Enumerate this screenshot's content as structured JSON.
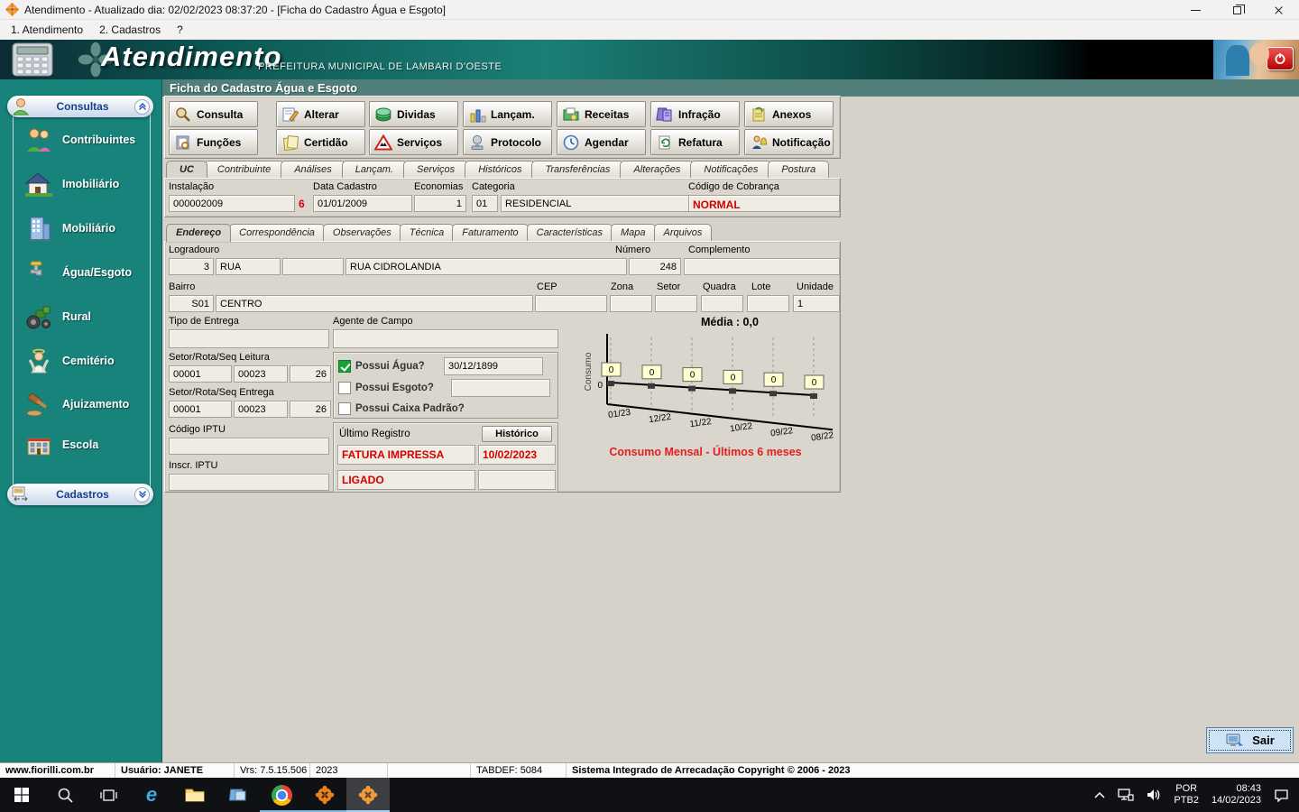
{
  "window": {
    "title": "Atendimento - Atualizado dia: 02/02/2023 08:37:20 - [Ficha do Cadastro Água e Esgoto]"
  },
  "menu_bar": {
    "items": [
      "1. Atendimento",
      "2. Cadastros",
      "?"
    ]
  },
  "banner": {
    "app_name": "Atendimento",
    "subtitle": "PREFEITURA MUNICIPAL DE LAMBARI D'OESTE"
  },
  "page": {
    "title": "Ficha do Cadastro Água e Esgoto"
  },
  "sidebar": {
    "consultas_label": "Consultas",
    "cadastros_label": "Cadastros",
    "items": [
      {
        "label": "Contribuintes",
        "icon": "people-icon"
      },
      {
        "label": "Imobiliário",
        "icon": "house-icon"
      },
      {
        "label": "Mobiliário",
        "icon": "building-icon"
      },
      {
        "label": "Água/Esgoto",
        "icon": "faucet-icon"
      },
      {
        "label": "Rural",
        "icon": "tractor-icon"
      },
      {
        "label": "Cemitério",
        "icon": "angel-icon"
      },
      {
        "label": "Ajuizamento",
        "icon": "gavel-icon"
      },
      {
        "label": "Escola",
        "icon": "school-icon"
      }
    ]
  },
  "toolbar": {
    "row1": [
      {
        "label": "Consulta",
        "icon": "magnifier-icon"
      },
      {
        "label": "Alterar",
        "icon": "edit-icon"
      },
      {
        "label": "Dividas",
        "icon": "books-icon"
      },
      {
        "label": "Lançam.",
        "icon": "chart-bars-icon"
      },
      {
        "label": "Receitas",
        "icon": "folder-money-icon"
      },
      {
        "label": "Infração",
        "icon": "violation-icon"
      },
      {
        "label": "Anexos",
        "icon": "attachment-icon"
      }
    ],
    "row2": [
      {
        "label": "Funções",
        "icon": "clipboard-icon"
      },
      {
        "label": "Certidão",
        "icon": "certificate-icon"
      },
      {
        "label": "Serviços",
        "icon": "warning-icon"
      },
      {
        "label": "Protocolo",
        "icon": "stamp-icon"
      },
      {
        "label": "Agendar",
        "icon": "clock-icon"
      },
      {
        "label": "Refatura",
        "icon": "refresh-doc-icon"
      },
      {
        "label": "Notificação",
        "icon": "notify-icon"
      }
    ]
  },
  "tabs": {
    "active": "UC",
    "items": [
      "UC",
      "Contribuinte",
      "Análises",
      "Lançam.",
      "Serviços",
      "Históricos",
      "Transferências",
      "Alterações",
      "Notificações",
      "Postura"
    ]
  },
  "record": {
    "instalacao_label": "Instalação",
    "instalacao": "000002009",
    "instalacao_flag": "6",
    "data_cadastro_label": "Data Cadastro",
    "data_cadastro": "01/01/2009",
    "economias_label": "Economias",
    "economias": "1",
    "categoria_label": "Categoria",
    "categoria_codigo": "01",
    "categoria_descricao": "RESIDENCIAL",
    "cobranca_label": "Código de Cobrança",
    "cobranca": "NORMAL"
  },
  "subtabs": {
    "active": "Endereço",
    "items": [
      "Endereço",
      "Correspondência",
      "Observações",
      "Técnica",
      "Faturamento",
      "Características",
      "Mapa",
      "Arquivos"
    ]
  },
  "address": {
    "logradouro_label": "Logradouro",
    "numero_label": "Número",
    "complemento_label": "Complemento",
    "logradouro_codigo": "3",
    "logradouro_tipo": "RUA",
    "logradouro_extra": "",
    "logradouro_nome": "RUA CIDROLANDIA",
    "numero": "248",
    "complemento": "",
    "bairro_label": "Bairro",
    "cep_label": "CEP",
    "zona_label": "Zona",
    "setor_label": "Setor",
    "quadra_label": "Quadra",
    "lote_label": "Lote",
    "unidade_label": "Unidade",
    "bairro_codigo": "S01",
    "bairro_nome": "CENTRO",
    "cep": "",
    "zona": "",
    "setor": "",
    "quadra": "",
    "lote": "",
    "unidade": "1",
    "tipo_entrega_label": "Tipo de Entrega",
    "tipo_entrega": "",
    "agente_campo_label": "Agente de Campo",
    "agente_campo": ""
  },
  "leitura": {
    "leitura_label": "Setor/Rota/Seq Leitura",
    "leitura_setor": "00001",
    "leitura_rota": "00023",
    "leitura_seq": "26",
    "entrega_label": "Setor/Rota/Seq Entrega",
    "entrega_setor": "00001",
    "entrega_rota": "00023",
    "entrega_seq": "26",
    "codigo_iptu_label": "Código IPTU",
    "codigo_iptu": "",
    "inscr_iptu_label": "Inscr. IPTU",
    "inscr_iptu": ""
  },
  "flags": {
    "agua": {
      "label": "Possui Água?",
      "checked": true,
      "date": "30/12/1899"
    },
    "esgoto": {
      "label": "Possui Esgoto?",
      "checked": false,
      "value": ""
    },
    "caixa": {
      "label": "Possui Caixa Padrão?",
      "checked": false
    }
  },
  "ultimo_registro": {
    "label": "Último Registro",
    "historico_button": "Histórico",
    "registro": "FATURA IMPRESSA",
    "registro_data": "10/02/2023",
    "status": "LIGADO",
    "status_extra": ""
  },
  "chart_data": {
    "type": "line",
    "title": "Consumo Mensal - Últimos 6 meses",
    "media_label": "Média : 0,0",
    "ylabel": "Consumo",
    "y_axis_tick": "0",
    "categories": [
      "01/23",
      "12/22",
      "11/22",
      "10/22",
      "09/22",
      "08/22"
    ],
    "values": [
      0,
      0,
      0,
      0,
      0,
      0
    ],
    "ylim": [
      0,
      0
    ],
    "grid": "dashed-vertical",
    "legend": false,
    "accent_color": "#e02020",
    "point_box_color": "#ffffcf"
  },
  "sair": {
    "label": "Sair",
    "icon": "exit-computer-icon"
  },
  "statusbar": {
    "segments": [
      "www.fiorilli.com.br",
      "Usuário: JANETE",
      "Vrs: 7.5.15.506",
      "2023",
      "",
      "TABDEF: 5084",
      "Sistema Integrado de Arrecadação Copyright © 2006 - 2023"
    ]
  },
  "taskbar": {
    "icons": [
      "start",
      "search",
      "task-view",
      "internet-explorer",
      "file-explorer",
      "paint-app",
      "chrome",
      "fiorilli",
      "fiorilli-active"
    ],
    "tray": {
      "lang_top": "POR",
      "lang_bottom": "PTB2",
      "time": "08:43",
      "date": "14/02/2023"
    }
  }
}
